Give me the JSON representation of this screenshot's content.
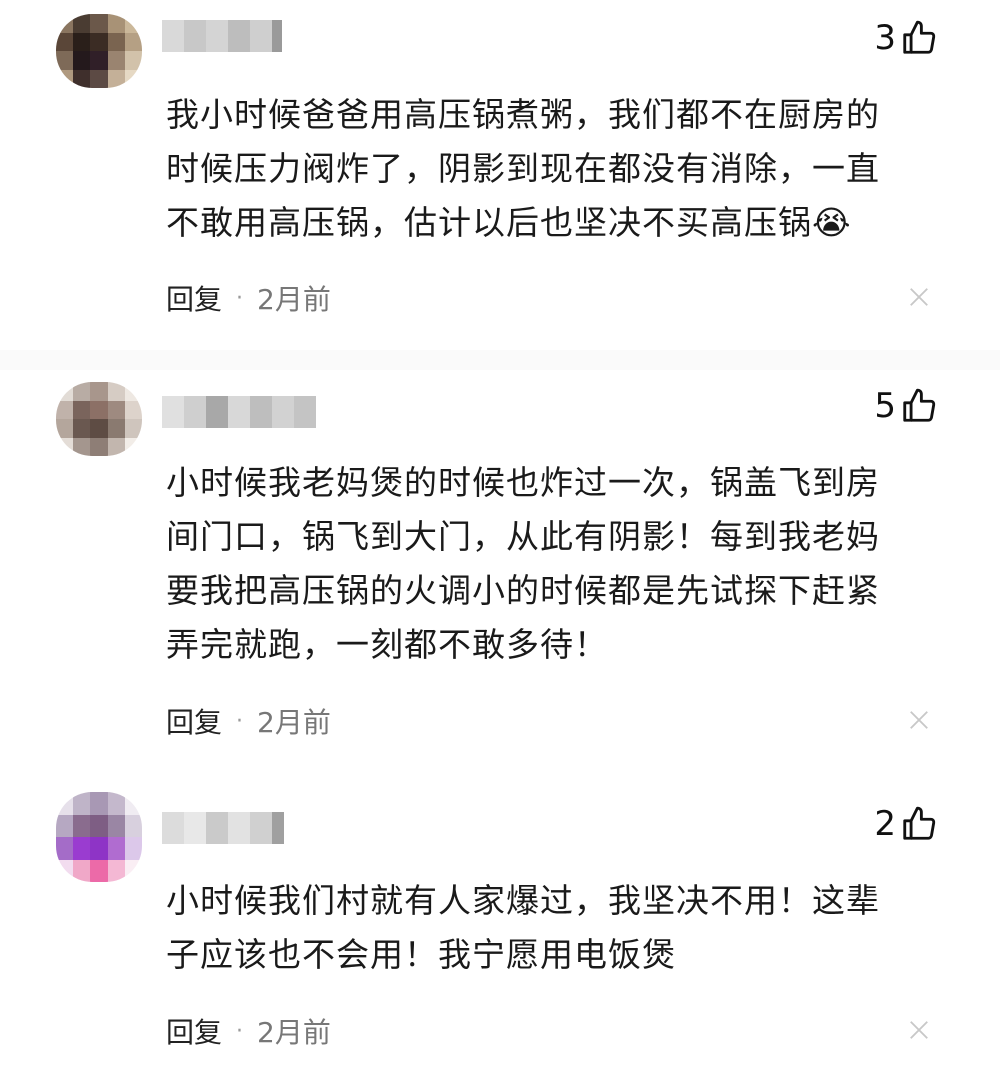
{
  "comments": [
    {
      "likes": "3",
      "text_lines": [
        "我小时候爸爸用高压锅煮粥，我们都不在厨房的",
        "时候压力阀炸了，阴影到现在都没有消除，一直",
        "不敢用高压锅，估计以后也坚决不买高压锅😭"
      ],
      "reply": "回复",
      "time": "2月前"
    },
    {
      "likes": "5",
      "text_lines": [
        "小时候我老妈煲的时候也炸过一次，锅盖飞到房",
        "间门口，锅飞到大门，从此有阴影！每到我老妈",
        "要我把高压锅的火调小的时候都是先试探下赶紧",
        "弄完就跑，一刻都不敢多待！"
      ],
      "reply": "回复",
      "time": "2月前"
    },
    {
      "likes": "2",
      "text_lines": [
        "小时候我们村就有人家爆过，我坚决不用！这辈",
        "子应该也不会用！我宁愿用电饭煲"
      ],
      "reply": "回复",
      "time": "2月前"
    }
  ],
  "colors": {
    "text": "#1a1a1a",
    "meta_time": "#777777",
    "close_icon": "#c8c8c8"
  },
  "icons": {
    "like": "thumbs-up-icon",
    "close": "close-icon"
  }
}
